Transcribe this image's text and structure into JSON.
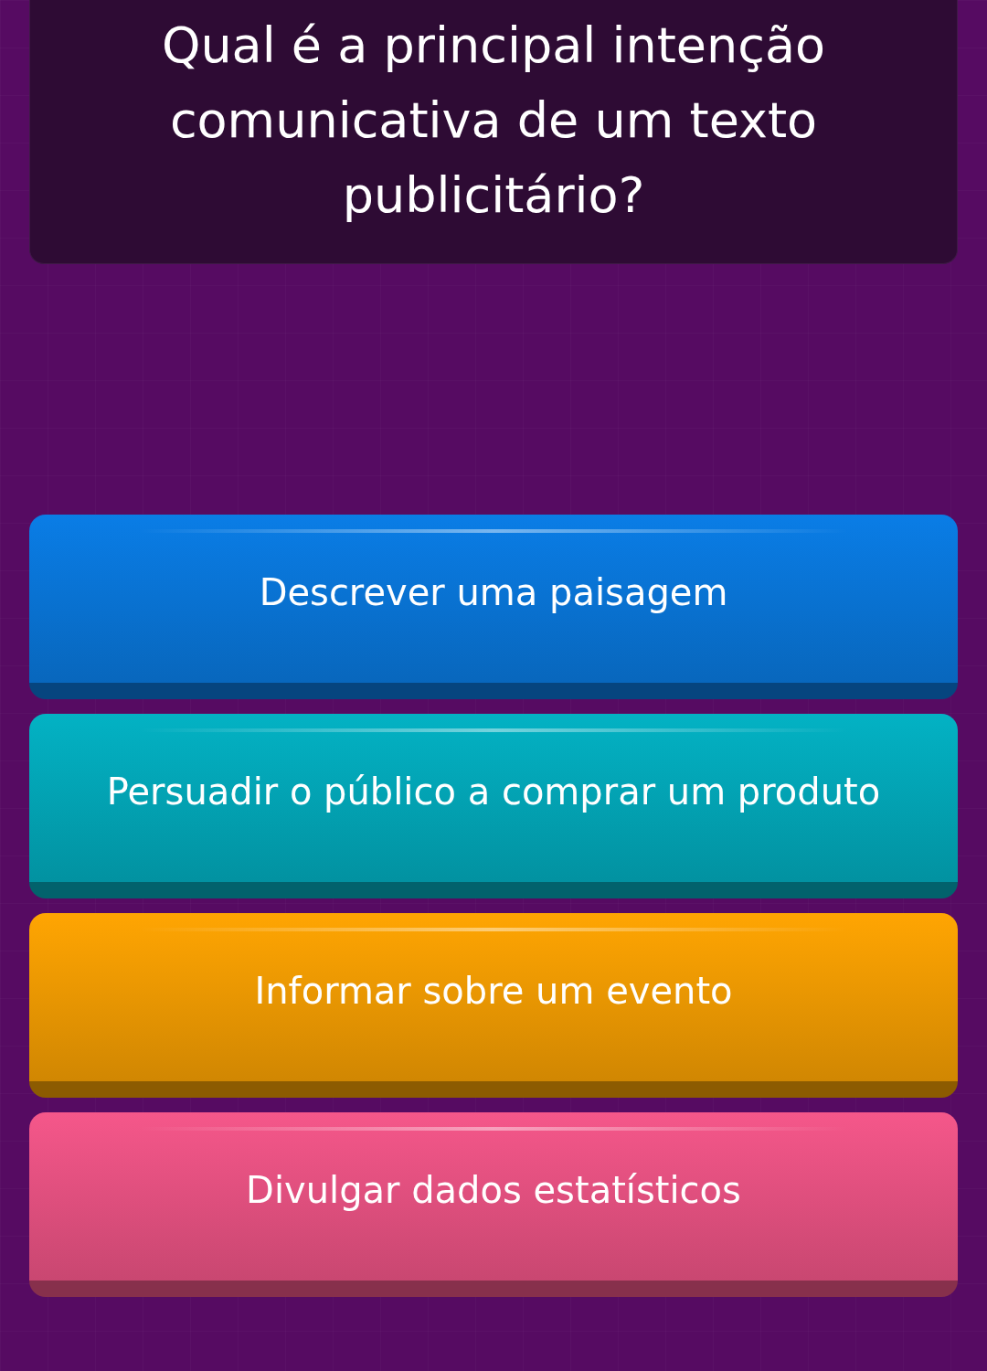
{
  "question": "Qual é a principal intenção comunicativa de um texto publicitário?",
  "answers": [
    {
      "label": "Descrever uma paisagem",
      "color": "#0a7de6"
    },
    {
      "label": "Persuadir o público a comprar um produto",
      "color": "#03b2c4"
    },
    {
      "label": "Informar sobre um evento",
      "color": "#ffa502"
    },
    {
      "label": "Divulgar dados estatísticos",
      "color": "#f5578a"
    }
  ]
}
